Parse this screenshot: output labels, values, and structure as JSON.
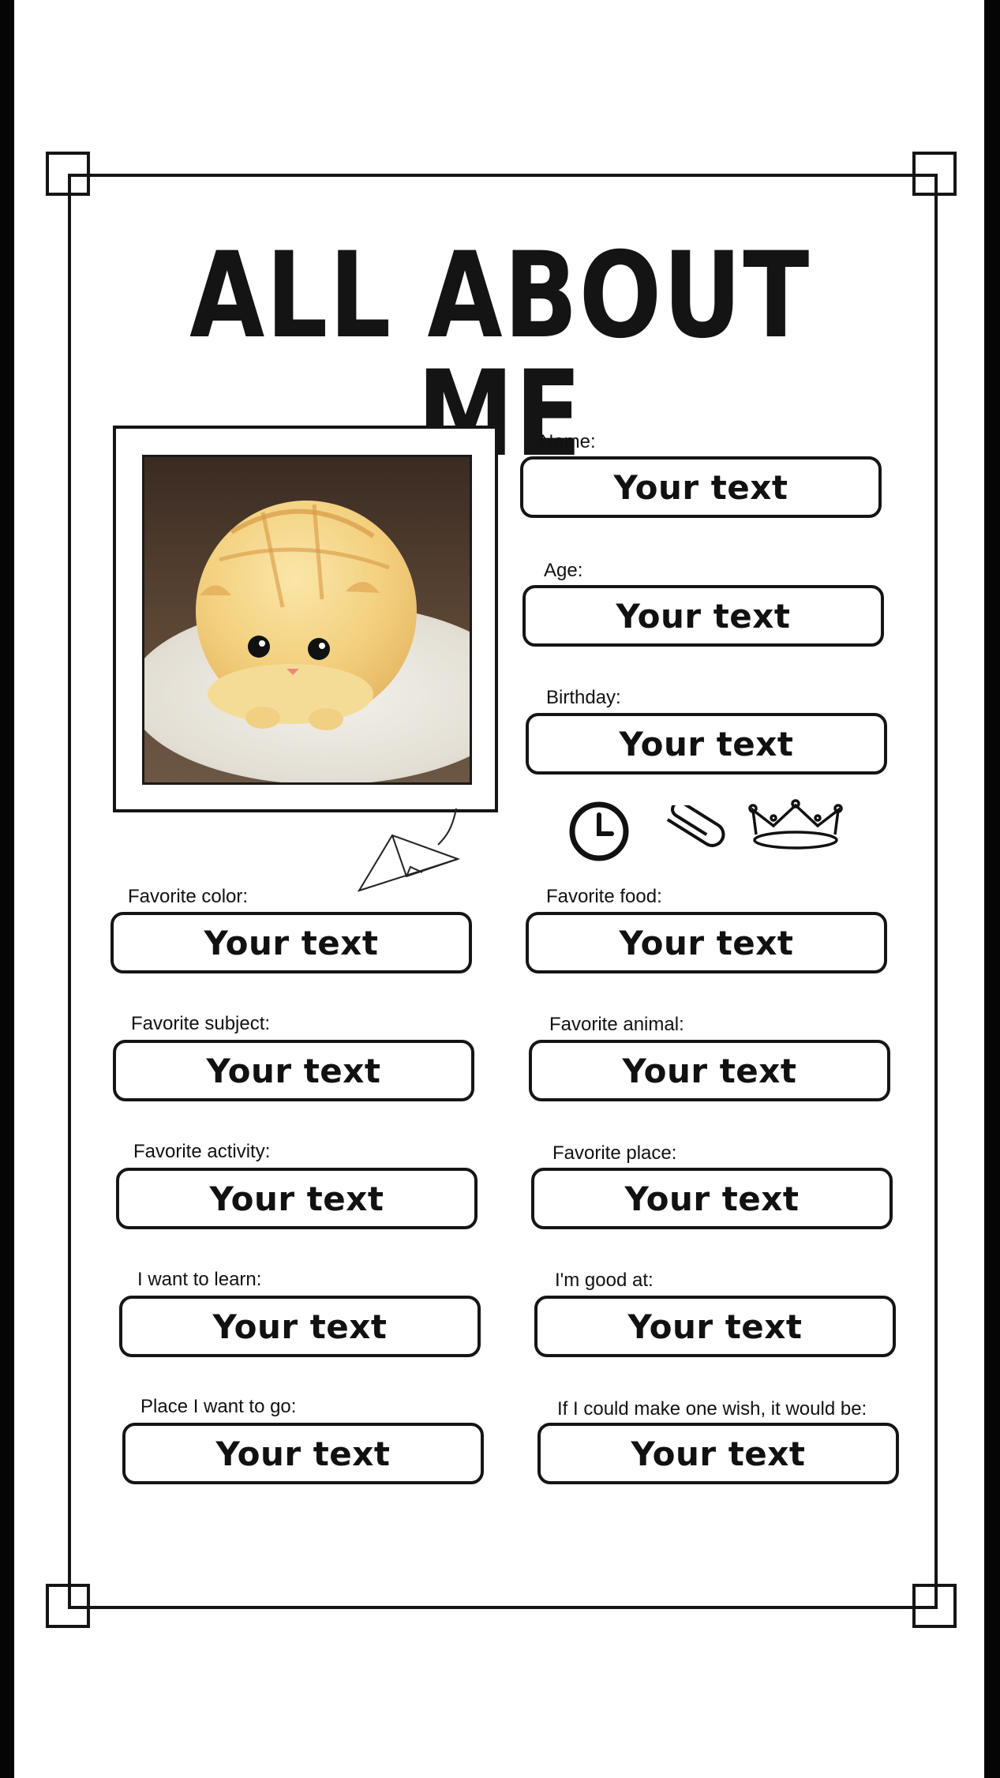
{
  "title": "ALL ABOUT ME",
  "photo": {
    "description_icon": "cat-bread-photo"
  },
  "fields": {
    "name": {
      "label": "Name:",
      "value": "Your text"
    },
    "age": {
      "label": "Age:",
      "value": "Your text"
    },
    "birthday": {
      "label": "Birthday:",
      "value": "Your text"
    },
    "favorite_color": {
      "label": "Favorite color:",
      "value": "Your text"
    },
    "favorite_food": {
      "label": "Favorite food:",
      "value": "Your text"
    },
    "favorite_subject": {
      "label": "Favorite subject:",
      "value": "Your text"
    },
    "favorite_animal": {
      "label": "Favorite animal:",
      "value": "Your text"
    },
    "favorite_activity": {
      "label": "Favorite activity:",
      "value": "Your text"
    },
    "favorite_place": {
      "label": "Favorite place:",
      "value": "Your text"
    },
    "want_to_learn": {
      "label": "I want to learn:",
      "value": "Your text"
    },
    "good_at": {
      "label": "I'm good at:",
      "value": "Your text"
    },
    "place_to_go": {
      "label": "Place I want to go:",
      "value": "Your text"
    },
    "wish": {
      "label": "If I could make one wish, it would be:",
      "value": "Your text"
    }
  },
  "icons": [
    "clock-icon",
    "paperclip-icon",
    "crown-icon",
    "paper-plane-icon"
  ],
  "colors": {
    "ink": "#151515",
    "background": "#ffffff"
  }
}
